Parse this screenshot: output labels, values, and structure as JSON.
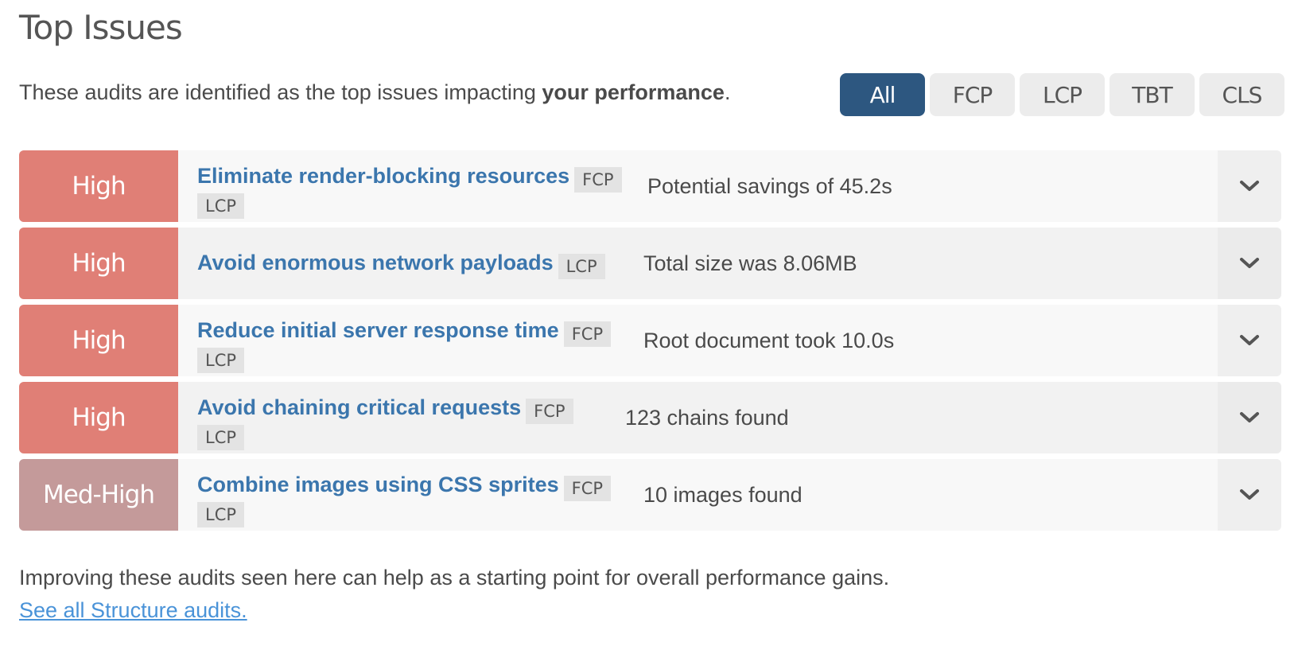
{
  "header": {
    "title": "Top Issues",
    "intro_prefix": "These audits are identified as the top issues impacting ",
    "intro_bold": "your performance",
    "intro_suffix": "."
  },
  "filters": [
    {
      "label": "All",
      "active": true
    },
    {
      "label": "FCP",
      "active": false
    },
    {
      "label": "LCP",
      "active": false
    },
    {
      "label": "TBT",
      "active": false
    },
    {
      "label": "CLS",
      "active": false
    }
  ],
  "colors": {
    "high": "#e07f76",
    "med_high": "#c49a9a",
    "accent": "#2d5780",
    "link": "#3b76ad"
  },
  "issues": [
    {
      "severity": "High",
      "severity_color": "#e07f76",
      "title": "Eliminate render-blocking resources",
      "tags": [
        "FCP",
        "LCP"
      ],
      "detail": "Potential savings of 45.2s"
    },
    {
      "severity": "High",
      "severity_color": "#e07f76",
      "title": "Avoid enormous network payloads",
      "tags": [
        "LCP"
      ],
      "detail": "Total size was 8.06MB"
    },
    {
      "severity": "High",
      "severity_color": "#e07f76",
      "title": "Reduce initial server response time",
      "tags": [
        "FCP",
        "LCP"
      ],
      "detail": "Root document took 10.0s"
    },
    {
      "severity": "High",
      "severity_color": "#e07f76",
      "title": "Avoid chaining critical requests",
      "tags": [
        "FCP",
        "LCP"
      ],
      "detail": "123 chains found"
    },
    {
      "severity": "Med-High",
      "severity_color": "#c49a9a",
      "title": "Combine images using CSS sprites",
      "tags": [
        "FCP",
        "LCP"
      ],
      "detail": "10 images found"
    }
  ],
  "footer": {
    "text": "Improving these audits seen here can help as a starting point for overall performance gains.",
    "link": "See all Structure audits."
  },
  "icons": {
    "expand": "chevron-down-icon"
  }
}
